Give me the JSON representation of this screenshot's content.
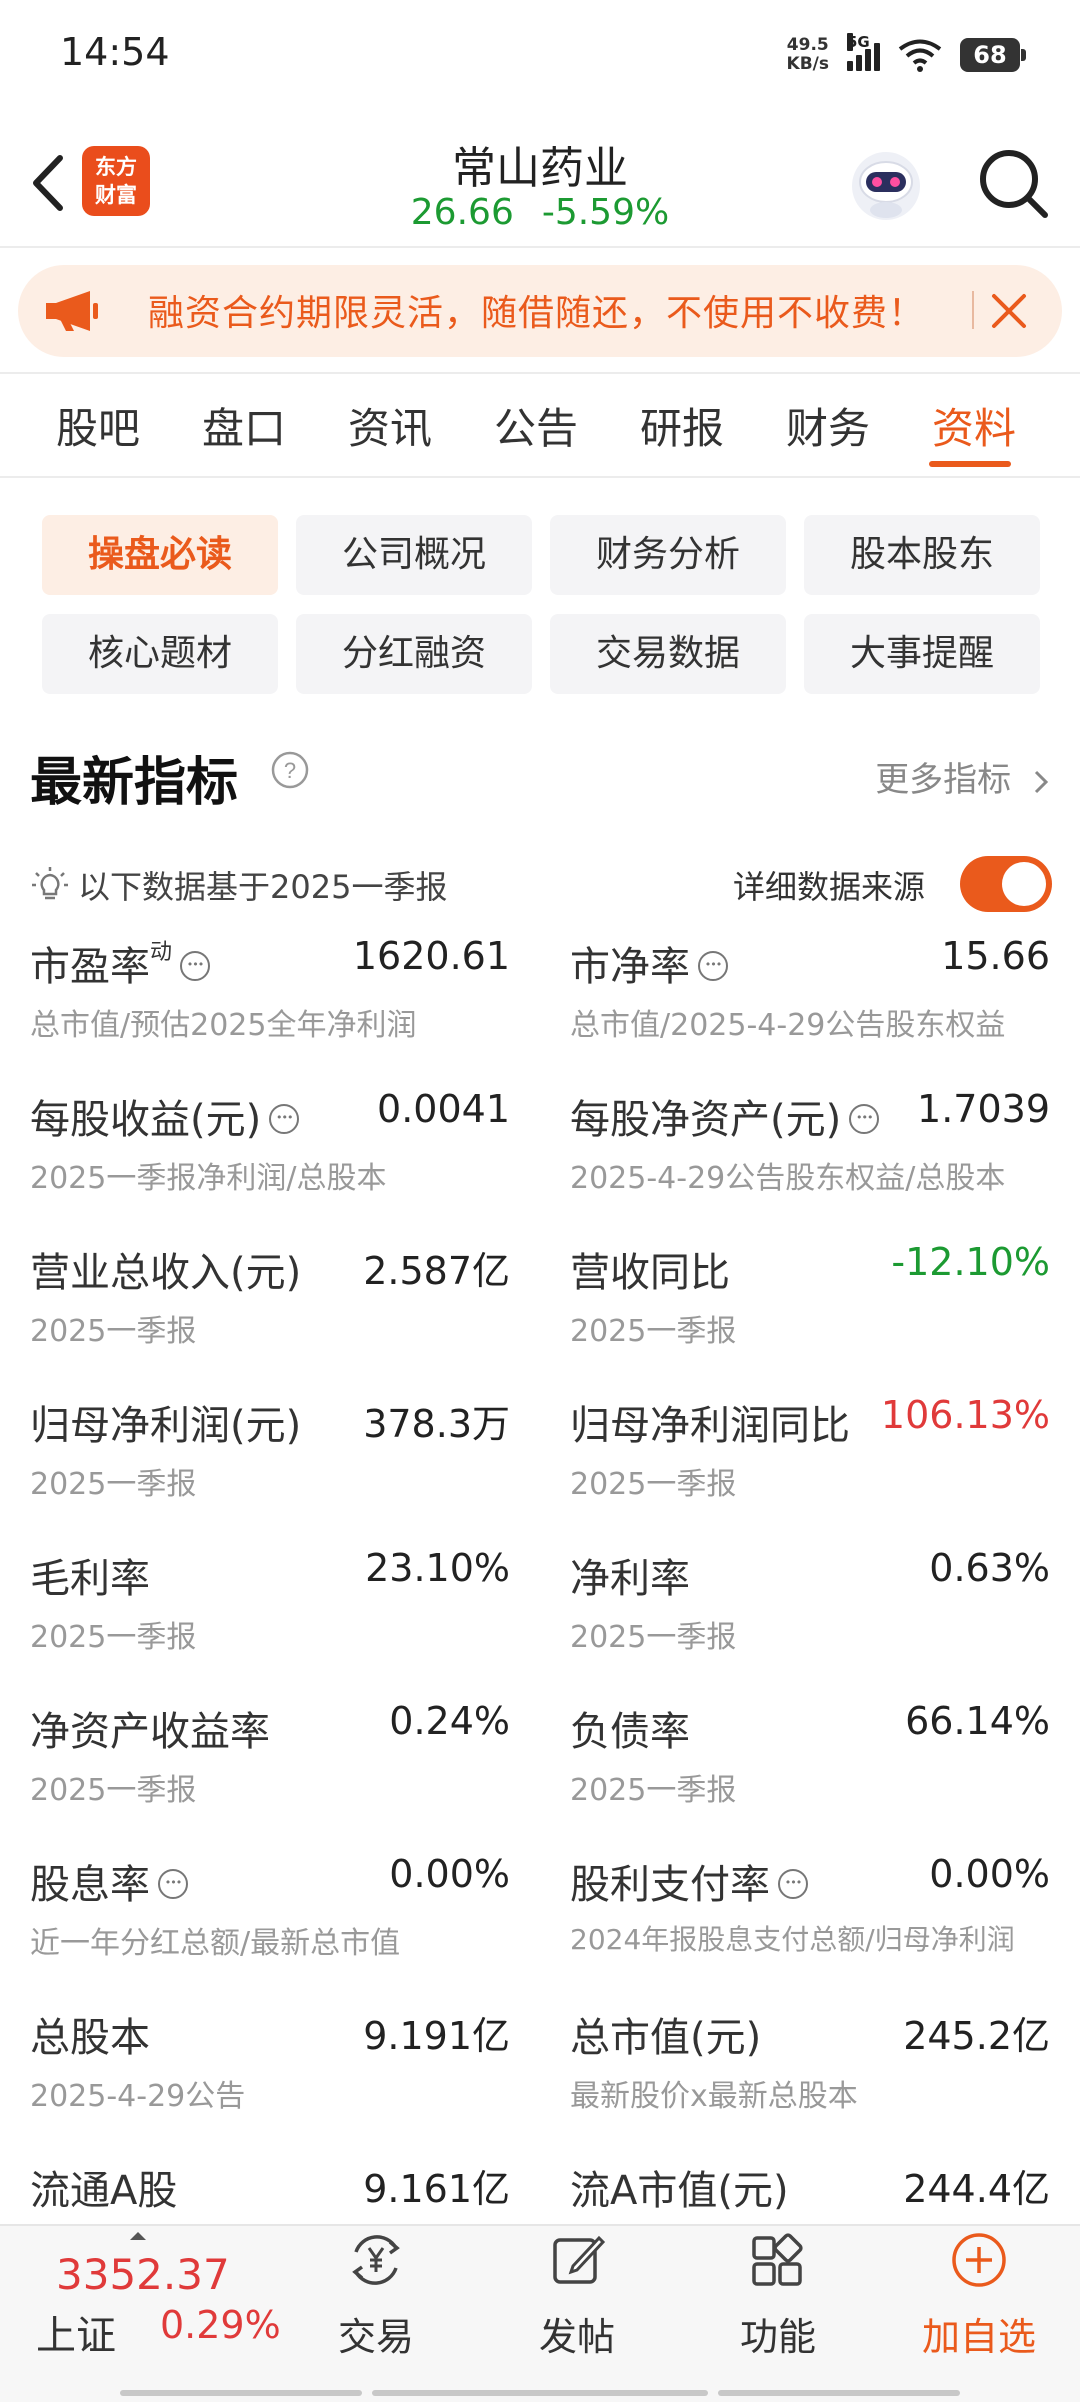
{
  "status": {
    "time": "14:54",
    "net_speed_value": "49.5",
    "net_speed_unit": "KB/s",
    "network": "5G",
    "battery": "68"
  },
  "header": {
    "logo_line1": "东方",
    "logo_line2": "财富",
    "stock_name": "常山药业",
    "price": "26.66",
    "change_pct": "-5.59%"
  },
  "banner": {
    "text": "融资合约期限灵活，随借随还，不使用不收费！"
  },
  "tabs": [
    "股吧",
    "盘口",
    "资讯",
    "公告",
    "研报",
    "财务",
    "资料"
  ],
  "active_tab": "资料",
  "sub_buttons": [
    "操盘必读",
    "公司概况",
    "财务分析",
    "股本股东",
    "核心题材",
    "分红融资",
    "交易数据",
    "大事提醒"
  ],
  "section": {
    "title": "最新指标",
    "more": "更多指标",
    "based_on": "以下数据基于2025一季报",
    "detail_source": "详细数据来源"
  },
  "metrics": [
    {
      "label": "市盈率",
      "sup": "动",
      "value": "1620.61",
      "sub": "总市值/预估2025全年净利润"
    },
    {
      "label": "市净率",
      "value": "15.66",
      "sub": "总市值/2025-4-29公告股东权益"
    },
    {
      "label": "每股收益(元)",
      "value": "0.0041",
      "sub": "2025一季报净利润/总股本"
    },
    {
      "label": "每股净资产(元)",
      "value": "1.7039",
      "sub": "2025-4-29公告股东权益/总股本"
    },
    {
      "label": "营业总收入(元)",
      "value": "2.587亿",
      "sub": "2025一季报"
    },
    {
      "label": "营收同比",
      "value": "-12.10%",
      "sub": "2025一季报"
    },
    {
      "label": "归母净利润(元)",
      "value": "378.3万",
      "sub": "2025一季报"
    },
    {
      "label": "归母净利润同比",
      "value": "106.13%",
      "sub": "2025一季报"
    },
    {
      "label": "毛利率",
      "value": "23.10%",
      "sub": "2025一季报"
    },
    {
      "label": "净利率",
      "value": "0.63%",
      "sub": "2025一季报"
    },
    {
      "label": "净资产收益率",
      "value": "0.24%",
      "sub": "2025一季报"
    },
    {
      "label": "负债率",
      "value": "66.14%",
      "sub": "2025一季报"
    },
    {
      "label": "股息率",
      "value": "0.00%",
      "sub": "近一年分红总额/最新总市值"
    },
    {
      "label": "股利支付率",
      "value": "0.00%",
      "sub": "2024年报股息支付总额/归母净利润"
    },
    {
      "label": "总股本",
      "value": "9.191亿",
      "sub": "2025-4-29公告"
    },
    {
      "label": "总市值(元)",
      "value": "245.2亿",
      "sub": "最新股价x最新总股本"
    },
    {
      "label": "流通A股",
      "value": "9.161亿",
      "sub": ""
    },
    {
      "label": "流A市值(元)",
      "value": "244.4亿",
      "sub": ""
    }
  ],
  "bottom": {
    "index_value": "3352.37",
    "index_name": "上证",
    "index_pct": "0.29%",
    "nav": [
      "交易",
      "发帖",
      "功能",
      "加自选"
    ]
  },
  "colors": {
    "accent": "#ea5a1c",
    "up": "#e03a3a",
    "down": "#1c9a32"
  }
}
